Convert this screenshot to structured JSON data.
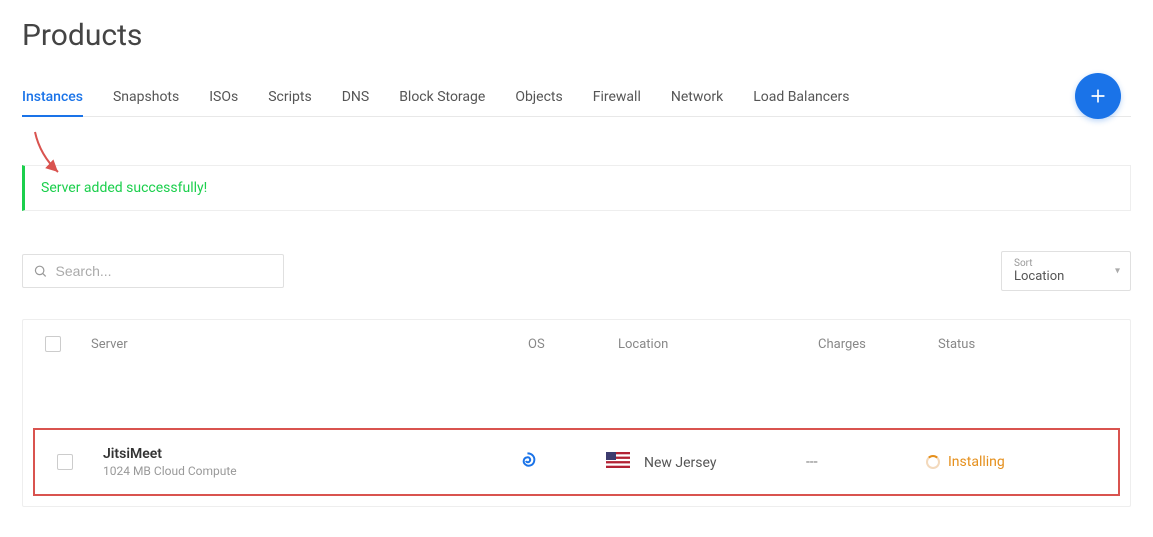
{
  "page_title": "Products",
  "tabs": [
    "Instances",
    "Snapshots",
    "ISOs",
    "Scripts",
    "DNS",
    "Block Storage",
    "Objects",
    "Firewall",
    "Network",
    "Load Balancers"
  ],
  "active_tab_index": 0,
  "alert_message": "Server added successfully!",
  "search": {
    "placeholder": "Search..."
  },
  "sort": {
    "label": "Sort",
    "value": "Location"
  },
  "table": {
    "headers": {
      "server": "Server",
      "os": "OS",
      "location": "Location",
      "charges": "Charges",
      "status": "Status"
    },
    "rows": [
      {
        "name": "JitsiMeet",
        "subtitle": "1024 MB Cloud Compute",
        "os_icon": "debian",
        "location": "New Jersey",
        "flag": "us",
        "charges": "---",
        "status": "Installing"
      }
    ]
  }
}
